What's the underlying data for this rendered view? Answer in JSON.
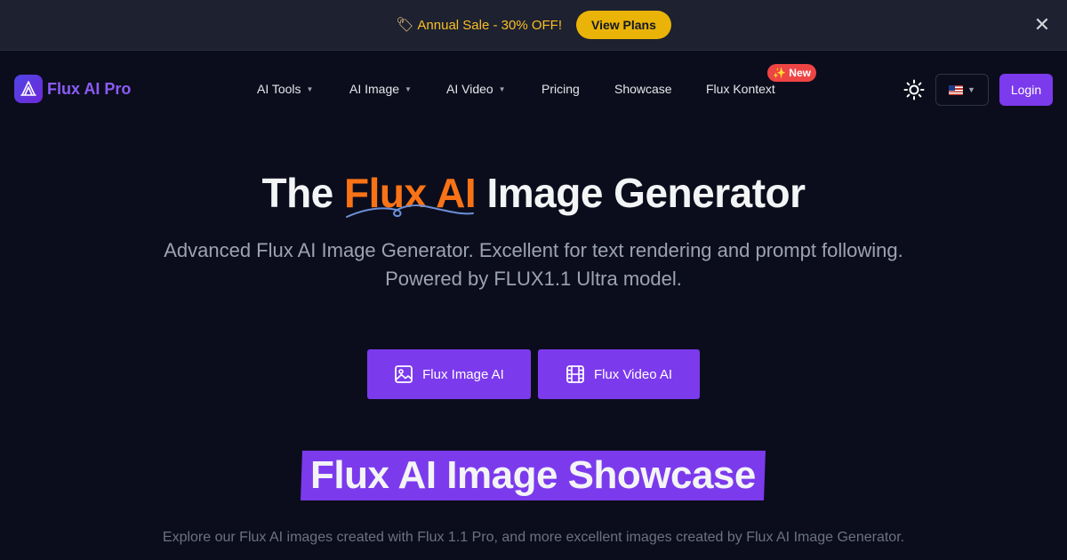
{
  "announcement": {
    "tag_icon": "tag-icon",
    "text": "Annual Sale - 30% OFF!",
    "button_label": "View Plans",
    "close_icon": "close-icon"
  },
  "nav": {
    "brand": "Flux AI Pro",
    "items": [
      {
        "label": "AI Tools",
        "dropdown": true
      },
      {
        "label": "AI Image",
        "dropdown": true
      },
      {
        "label": "AI Video",
        "dropdown": true
      },
      {
        "label": "Pricing",
        "dropdown": false
      },
      {
        "label": "Showcase",
        "dropdown": false
      },
      {
        "label": "Flux Kontext",
        "dropdown": false
      }
    ],
    "new_badge": "✨ New",
    "theme_icon": "sun-icon",
    "language_icon": "us-flag-icon",
    "login_label": "Login"
  },
  "hero": {
    "title_before": "The ",
    "title_highlight": "Flux AI",
    "title_after": " Image Generator",
    "subtitle_line1": "Advanced Flux AI Image Generator. Excellent for text rendering and prompt following.",
    "subtitle_line2": "Powered by FLUX1.1 Ultra model.",
    "buttons": [
      {
        "label": "Flux Image AI",
        "icon": "image-icon"
      },
      {
        "label": "Flux Video AI",
        "icon": "film-icon"
      }
    ]
  },
  "showcase": {
    "title": "Flux AI Image Showcase",
    "subtitle": "Explore our Flux AI images created with Flux 1.1 Pro, and more excellent images created by Flux AI Image Generator."
  },
  "colors": {
    "background": "#0c0d1c",
    "accent": "#7c3aed",
    "highlight": "#f97316",
    "sale": "#eab308"
  }
}
